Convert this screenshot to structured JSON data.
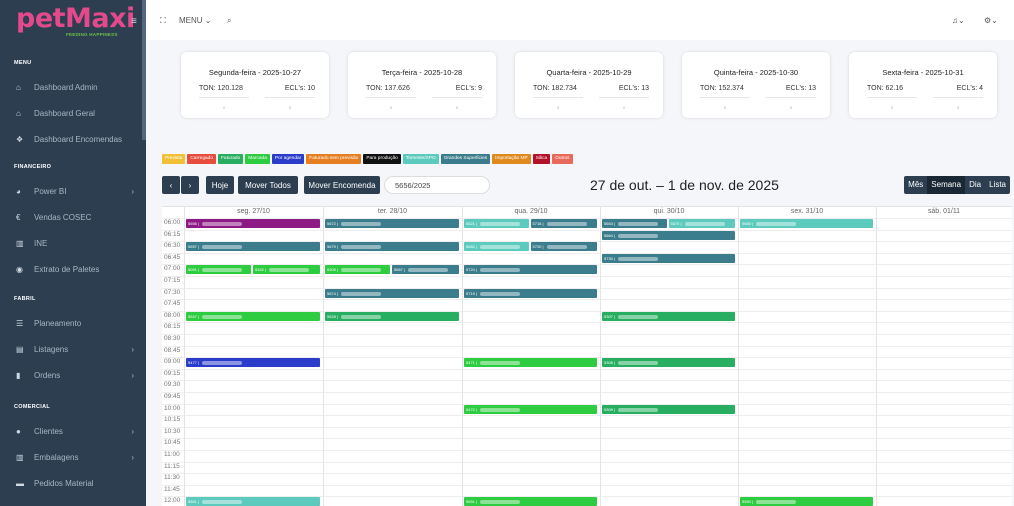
{
  "app": {
    "logo_text": "petMaxi",
    "logo_tagline": "FEEDING HAPPINESS"
  },
  "sidebar": {
    "sections": [
      {
        "label": "MENU",
        "items": [
          {
            "label": "Dashboard Admin",
            "icon": "home-icon"
          },
          {
            "label": "Dashboard Geral",
            "icon": "home-icon"
          },
          {
            "label": "Dashboard Encomendas",
            "icon": "gift-icon"
          }
        ]
      },
      {
        "label": "FINANCEIRO",
        "items": [
          {
            "label": "Power BI",
            "icon": "chart-pie-icon",
            "chevron": true
          },
          {
            "label": "Vendas COSEC",
            "icon": "euro-icon"
          },
          {
            "label": "INE",
            "icon": "bar-chart-icon"
          },
          {
            "label": "Extrato de Paletes",
            "icon": "eye-icon"
          }
        ]
      },
      {
        "label": "FABRIL",
        "items": [
          {
            "label": "Planeamento",
            "icon": "list-icon"
          },
          {
            "label": "Listagens",
            "icon": "table-icon",
            "chevron": true
          },
          {
            "label": "Ordens",
            "icon": "file-icon",
            "chevron": true
          }
        ]
      },
      {
        "label": "COMERCIAL",
        "items": [
          {
            "label": "Clientes",
            "icon": "user-icon",
            "chevron": true
          },
          {
            "label": "Embalagens",
            "icon": "bar-chart-icon",
            "chevron": true
          },
          {
            "label": "Pedidos Material",
            "icon": "truck-icon"
          }
        ]
      }
    ]
  },
  "topbar": {
    "menu_label": "MENU",
    "expand_icon": "expand-icon",
    "search_icon": "search-icon",
    "bell_icon": "bell-icon",
    "settings_icon": "gear-icon"
  },
  "cards": [
    {
      "title": "Segunda-feira - 2025-10-27",
      "ton": "TON: 120.128",
      "ecl": "ECL's: 10"
    },
    {
      "title": "Terça-feira - 2025-10-28",
      "ton": "TON: 137.626",
      "ecl": "ECL's: 9"
    },
    {
      "title": "Quarta-feira - 2025-10-29",
      "ton": "TON: 182.734",
      "ecl": "ECL's: 13"
    },
    {
      "title": "Quinta-feira - 2025-10-30",
      "ton": "TON: 152.374",
      "ecl": "ECL's: 13"
    },
    {
      "title": "Sexta-feira - 2025-10-31",
      "ton": "TON: 62.16",
      "ecl": "ECL's: 4"
    }
  ],
  "legend": [
    {
      "label": "Prevista",
      "color": "#f2c037"
    },
    {
      "label": "Carregado",
      "color": "#e74c3c"
    },
    {
      "label": "Faturado",
      "color": "#27ae60"
    },
    {
      "label": "Marcada",
      "color": "#2ecc40"
    },
    {
      "label": "Por agendar",
      "color": "#2a3cc9"
    },
    {
      "label": "Faturado sem previsão",
      "color": "#e67e22"
    },
    {
      "label": "Para produção",
      "color": "#111111"
    },
    {
      "label": "Torneste/XPO",
      "color": "#5ccbbd"
    },
    {
      "label": "Grandes Superficies",
      "color": "#3b7d8c"
    },
    {
      "label": "Importação MP",
      "color": "#e08a1e"
    },
    {
      "label": "Silica",
      "color": "#b3102a"
    },
    {
      "label": "Outros",
      "color": "#e96a5a"
    }
  ],
  "toolbar": {
    "prev": "‹",
    "next": "›",
    "today": "Hoje",
    "move_all": "Mover Todos",
    "move_order": "Mover Encomenda",
    "order_value": "5656/2025",
    "range": "27 de out. – 1 de nov. de 2025",
    "views": [
      "Mês",
      "Semana",
      "Dia",
      "Lista"
    ],
    "active_view": "Semana"
  },
  "calendar": {
    "days": [
      "seg. 27/10",
      "ter. 28/10",
      "qua. 29/10",
      "qui. 30/10",
      "sex. 31/10",
      "sáb. 01/11"
    ],
    "times": [
      "06:00",
      "06:15",
      "06:30",
      "06:45",
      "07:00",
      "07:15",
      "07:30",
      "07:45",
      "08:00",
      "08:15",
      "08:30",
      "08:45",
      "09:00",
      "09:15",
      "09:30",
      "09:45",
      "10:00",
      "10:15",
      "10:30",
      "10:45",
      "11:00",
      "11:15",
      "11:30",
      "11:45",
      "12:00"
    ],
    "events": [
      {
        "day": 0,
        "slot": 0,
        "label": "5656 |",
        "color": "#8e1a86"
      },
      {
        "day": 1,
        "slot": 0,
        "label": "5672 |",
        "color": "#3b7d8c"
      },
      {
        "day": 2,
        "slot": 0,
        "label": "5621 |",
        "color": "#5ccbbd",
        "half": 1
      },
      {
        "day": 2,
        "slot": 0,
        "label": "5716 |",
        "color": "#3b7d8c",
        "half": 2
      },
      {
        "day": 3,
        "slot": 0,
        "label": "5663 |",
        "color": "#3b7d8c",
        "half": 1
      },
      {
        "day": 3,
        "slot": 0,
        "label": "5670 |",
        "color": "#5ccbbd",
        "half": 2
      },
      {
        "day": 4,
        "slot": 0,
        "label": "5683 |",
        "color": "#5ccbbd"
      },
      {
        "day": 3,
        "slot": 1,
        "label": "5664 |",
        "color": "#3b7d8c"
      },
      {
        "day": 0,
        "slot": 2,
        "label": "5657 |",
        "color": "#3b7d8c"
      },
      {
        "day": 1,
        "slot": 2,
        "label": "5679 |",
        "color": "#3b7d8c"
      },
      {
        "day": 2,
        "slot": 2,
        "label": "5682 |",
        "color": "#5ccbbd",
        "half": 1
      },
      {
        "day": 2,
        "slot": 2,
        "label": "5720 |",
        "color": "#3b7d8c",
        "half": 2
      },
      {
        "day": 3,
        "slot": 3,
        "label": "5730 |",
        "color": "#3b7d8c"
      },
      {
        "day": 0,
        "slot": 4,
        "label": "5091 |",
        "color": "#2ecc40",
        "half": 1
      },
      {
        "day": 0,
        "slot": 4,
        "label": "5342 |",
        "color": "#2ecc40",
        "half": 2
      },
      {
        "day": 1,
        "slot": 4,
        "label": "5309 |",
        "color": "#2ecc40",
        "half": 1
      },
      {
        "day": 1,
        "slot": 4,
        "label": "5667 |",
        "color": "#3b7d8c",
        "half": 2
      },
      {
        "day": 2,
        "slot": 4,
        "label": "5724 |",
        "color": "#3b7d8c"
      },
      {
        "day": 1,
        "slot": 6,
        "label": "5674 |",
        "color": "#3b7d8c"
      },
      {
        "day": 2,
        "slot": 6,
        "label": "5719 |",
        "color": "#3b7d8c"
      },
      {
        "day": 0,
        "slot": 8,
        "label": "5547 |",
        "color": "#2ecc40"
      },
      {
        "day": 1,
        "slot": 8,
        "label": "5528 |",
        "color": "#27ae60"
      },
      {
        "day": 3,
        "slot": 8,
        "label": "5307 |",
        "color": "#27ae60"
      },
      {
        "day": 0,
        "slot": 12,
        "label": "5477 |",
        "color": "#2a3cc9"
      },
      {
        "day": 2,
        "slot": 12,
        "label": "5471 |",
        "color": "#2ecc40"
      },
      {
        "day": 3,
        "slot": 12,
        "label": "5308 |",
        "color": "#27ae60"
      },
      {
        "day": 2,
        "slot": 16,
        "label": "5472 |",
        "color": "#2ecc40"
      },
      {
        "day": 3,
        "slot": 16,
        "label": "5309 |",
        "color": "#27ae60"
      },
      {
        "day": 0,
        "slot": 24,
        "label": "5551 |",
        "color": "#5ccbbd"
      },
      {
        "day": 2,
        "slot": 24,
        "label": "5551 |",
        "color": "#2ecc40"
      },
      {
        "day": 4,
        "slot": 24,
        "label": "5550 |",
        "color": "#2ecc40"
      }
    ]
  }
}
